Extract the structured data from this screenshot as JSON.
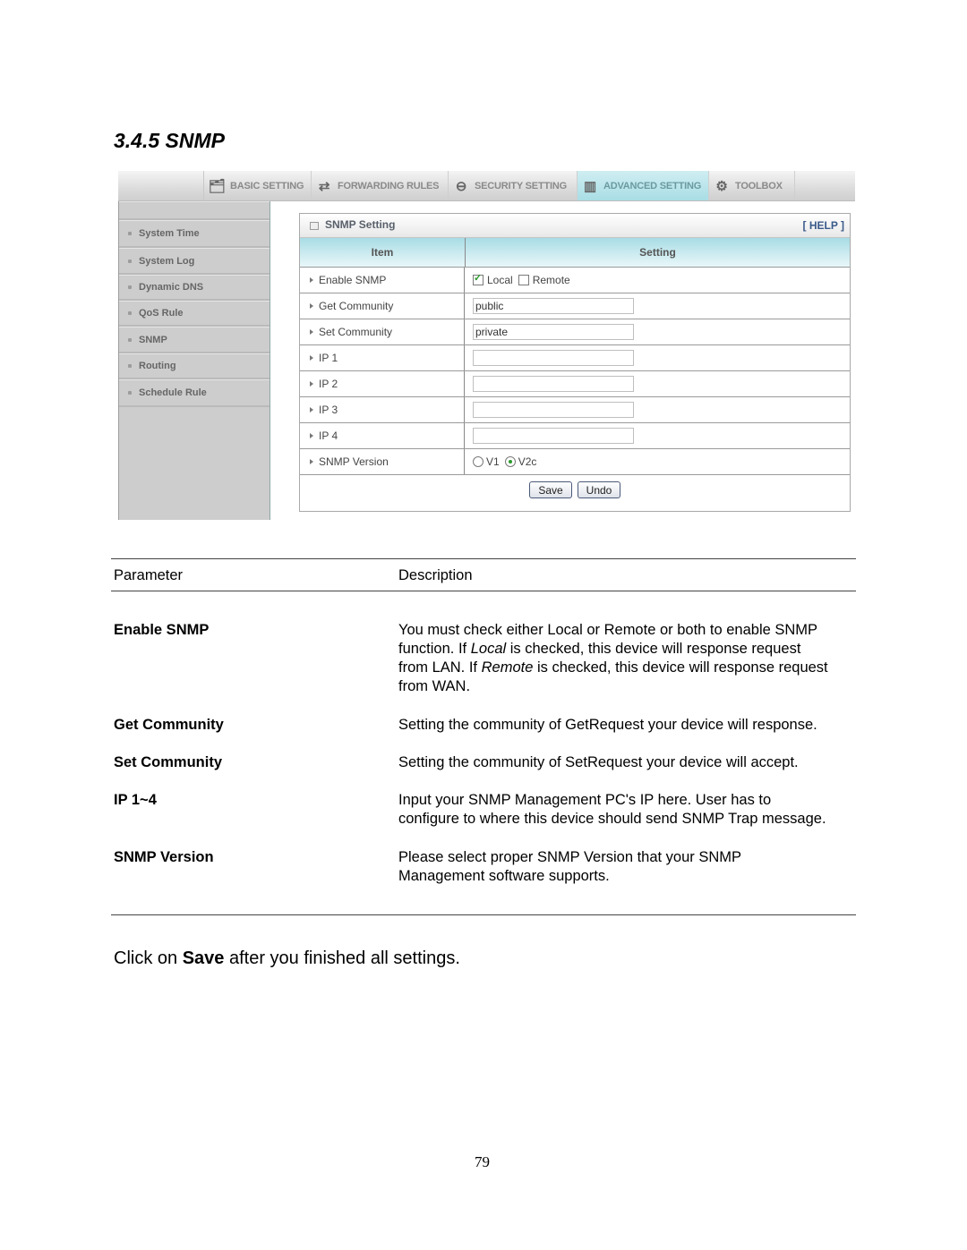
{
  "section_title": "3.4.5 SNMP",
  "router_ui": {
    "nav_tabs": [
      {
        "label": "BASIC SETTING",
        "icon": "folder-docs-icon",
        "active": false
      },
      {
        "label": "FORWARDING RULES",
        "icon": "forwarding-arrows-icon",
        "active": false
      },
      {
        "label": "SECURITY SETTING",
        "icon": "security-lock-icon",
        "active": false
      },
      {
        "label": "ADVANCED SETTING",
        "icon": "advanced-settings-icon",
        "active": true
      },
      {
        "label": "TOOLBOX",
        "icon": "toolbox-gear-icon",
        "active": false
      }
    ],
    "sidebar": [
      {
        "label": "System Time"
      },
      {
        "label": "System Log"
      },
      {
        "label": "Dynamic DNS"
      },
      {
        "label": "QoS Rule"
      },
      {
        "label": "SNMP"
      },
      {
        "label": "Routing"
      },
      {
        "label": "Schedule Rule"
      }
    ],
    "panel": {
      "title": "SNMP Setting",
      "help": "[ HELP ]",
      "col_item": "Item",
      "col_setting": "Setting",
      "rows": {
        "enable_snmp": {
          "label": "Enable SNMP",
          "local_label": "Local",
          "local_checked": true,
          "remote_label": "Remote",
          "remote_checked": false
        },
        "get_community": {
          "label": "Get Community",
          "value": "public"
        },
        "set_community": {
          "label": "Set Community",
          "value": "private"
        },
        "ip1": {
          "label": "IP 1",
          "value": ""
        },
        "ip2": {
          "label": "IP 2",
          "value": ""
        },
        "ip3": {
          "label": "IP 3",
          "value": ""
        },
        "ip4": {
          "label": "IP 4",
          "value": ""
        },
        "snmp_version": {
          "label": "SNMP Version",
          "v1_label": "V1",
          "v2c_label": "V2c",
          "selected": "V2c"
        }
      },
      "save_label": "Save",
      "undo_label": "Undo"
    }
  },
  "param_table": {
    "header_param": "Parameter",
    "header_desc": "Description",
    "rows": [
      {
        "name": "Enable SNMP",
        "lines": [
          "You must check either Local or Remote or both to enable SNMP",
          "function. If |Local| is checked, this device will response request",
          "from LAN. If |Remote| is checked, this device will response request",
          "from WAN."
        ]
      },
      {
        "name": "Get Community",
        "lines": [
          "Setting the community of GetRequest your device will response."
        ]
      },
      {
        "name": "Set Community",
        "lines": [
          "Setting the community of SetRequest your device will accept."
        ]
      },
      {
        "name": "IP 1~4",
        "lines": [
          "Input your SNMP Management PC's IP here. User has to",
          "configure to where this device should send SNMP Trap message."
        ]
      },
      {
        "name": "SNMP Version",
        "lines": [
          "Please select proper SNMP Version that your SNMP",
          "Management software supports."
        ]
      }
    ]
  },
  "footer": {
    "pre": "Click on ",
    "bold": "Save",
    "post": " after you finished all settings."
  },
  "page_number": "79"
}
